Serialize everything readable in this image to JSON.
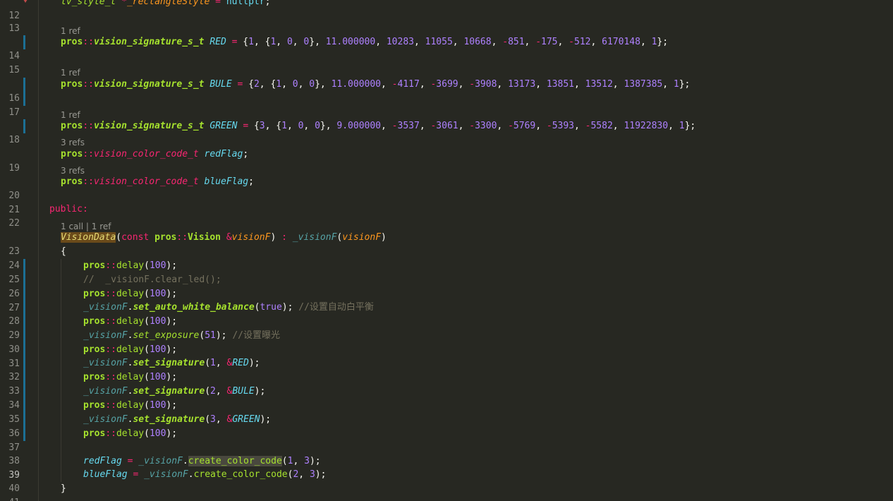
{
  "editor": {
    "lines": [
      {
        "n": "12",
        "code": "lv_style_t *_rectangleStyle = nullptr;",
        "mod": false,
        "fold": true
      },
      {
        "n": "13",
        "code": "",
        "mod": false
      },
      {
        "lens": "1 ref"
      },
      {
        "n": "14",
        "code": "pros::vision_signature_s_t RED = {1, {1, 0, 0}, 11.000000, 10283, 11055, 10668, -851, -175, -512, 6170148, 1};",
        "mod": true
      },
      {
        "n": "15",
        "code": "",
        "mod": false
      },
      {
        "lens": "1 ref"
      },
      {
        "n": "16",
        "code": "pros::vision_signature_s_t BULE = {2, {1, 0, 0}, 11.000000, -4117, -3699, -3908, 13173, 13851, 13512, 1387385, 1};",
        "mod": true
      },
      {
        "n": "17",
        "code": "",
        "mod": true
      },
      {
        "lens": "1 ref"
      },
      {
        "n": "18",
        "code": "pros::vision_signature_s_t GREEN = {3, {1, 0, 0}, 9.000000, -3537, -3061, -3300, -5769, -5393, -5582, 11922830, 1};",
        "mod": true
      },
      {
        "lens": "3 refs"
      },
      {
        "n": "19",
        "code": "pros::vision_color_code_t redFlag;",
        "mod": false
      },
      {
        "lens": "3 refs"
      },
      {
        "n": "20",
        "code": "pros::vision_color_code_t blueFlag;",
        "mod": false
      },
      {
        "n": "21",
        "code": "",
        "mod": false
      },
      {
        "n": "22",
        "code": "public:",
        "mod": false
      },
      {
        "lens": "1 call | 1 ref"
      },
      {
        "n": "23",
        "code": "VisionData(const pros::Vision &visionF) : _visionF(visionF)",
        "mod": false
      },
      {
        "n": "24",
        "code": "{",
        "mod": false
      },
      {
        "n": "25",
        "code": "pros::delay(100);",
        "mod": true
      },
      {
        "n": "26",
        "code": "//  _visionF.clear_led();",
        "mod": true
      },
      {
        "n": "27",
        "code": "pros::delay(100);",
        "mod": true
      },
      {
        "n": "28",
        "code": "_visionF.set_auto_white_balance(true); //设置自动白平衡",
        "mod": true
      },
      {
        "n": "29",
        "code": "pros::delay(100);",
        "mod": true
      },
      {
        "n": "30",
        "code": "_visionF.set_exposure(51); //设置曝光",
        "mod": true
      },
      {
        "n": "31",
        "code": "pros::delay(100);",
        "mod": true
      },
      {
        "n": "32",
        "code": "_visionF.set_signature(1, &RED);",
        "mod": true
      },
      {
        "n": "33",
        "code": "pros::delay(100);",
        "mod": true
      },
      {
        "n": "34",
        "code": "_visionF.set_signature(2, &BULE);",
        "mod": true
      },
      {
        "n": "35",
        "code": "pros::delay(100);",
        "mod": true
      },
      {
        "n": "36",
        "code": "_visionF.set_signature(3, &GREEN);",
        "mod": true
      },
      {
        "n": "37",
        "code": "pros::delay(100);",
        "mod": true
      },
      {
        "n": "38",
        "code": "",
        "mod": false
      },
      {
        "n": "39",
        "code": "redFlag = _visionF.create_color_code(1, 3);",
        "mod": false,
        "active": true
      },
      {
        "n": "40",
        "code": "blueFlag = _visionF.create_color_code(2, 3);",
        "mod": false
      },
      {
        "n": "41",
        "code": "}",
        "mod": false
      }
    ]
  },
  "colors": {
    "background": "#272822",
    "gutter_text": "#90908a",
    "modified_bar": "#1c6f94",
    "keyword_pink": "#f92672",
    "function_green": "#a6e22e",
    "number_purple": "#ae81ff",
    "type_cyan": "#66d9ef",
    "comment_grey": "#75715e"
  }
}
